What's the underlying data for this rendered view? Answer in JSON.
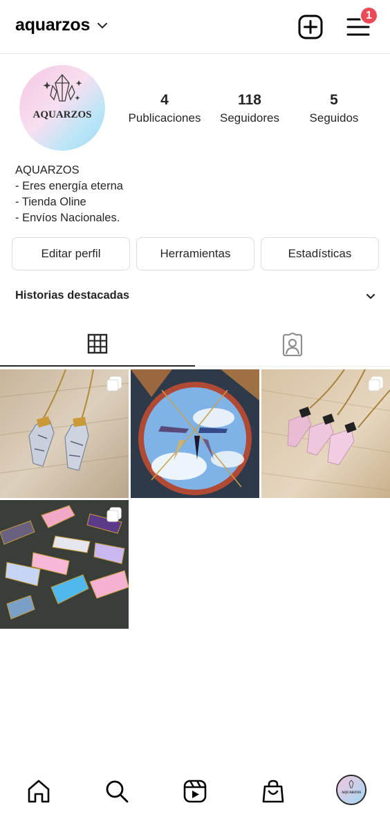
{
  "header": {
    "username": "aquarzos",
    "notification_count": "1",
    "icons": {
      "dropdown": "chevron-down-icon",
      "new_post": "plus-square-icon",
      "menu": "hamburger-menu-icon"
    }
  },
  "profile": {
    "avatar_text": "AQUARZOS",
    "stats": [
      {
        "value": "4",
        "label": "Publicaciones"
      },
      {
        "value": "118",
        "label": "Seguidores"
      },
      {
        "value": "5",
        "label": "Seguidos"
      }
    ],
    "bio": {
      "name": "AQUARZOS",
      "lines": [
        "- Eres energía eterna",
        "- Tienda Oline",
        "- Envíos Nacionales."
      ]
    }
  },
  "actions": {
    "edit_profile": "Editar perfil",
    "tools": "Herramientas",
    "insights": "Estadísticas"
  },
  "highlights": {
    "title": "Historias destacadas"
  },
  "tabs": {
    "grid_icon": "grid-icon",
    "tagged_icon": "tagged-person-icon"
  },
  "posts": [
    {
      "subject": "howlite pendant necklaces on wood",
      "multi": true
    },
    {
      "subject": "crystal pendants arranged around mirror",
      "multi": false
    },
    {
      "subject": "rose quartz pendants on wood",
      "multi": true
    },
    {
      "subject": "assorted crystal pendants",
      "multi": true
    }
  ],
  "bottom_nav": {
    "items": [
      "home-icon",
      "search-icon",
      "reels-icon",
      "shop-icon",
      "profile-avatar"
    ]
  },
  "colors": {
    "badge": "#ed4956",
    "text": "#262626",
    "border": "#dbdbdb"
  }
}
